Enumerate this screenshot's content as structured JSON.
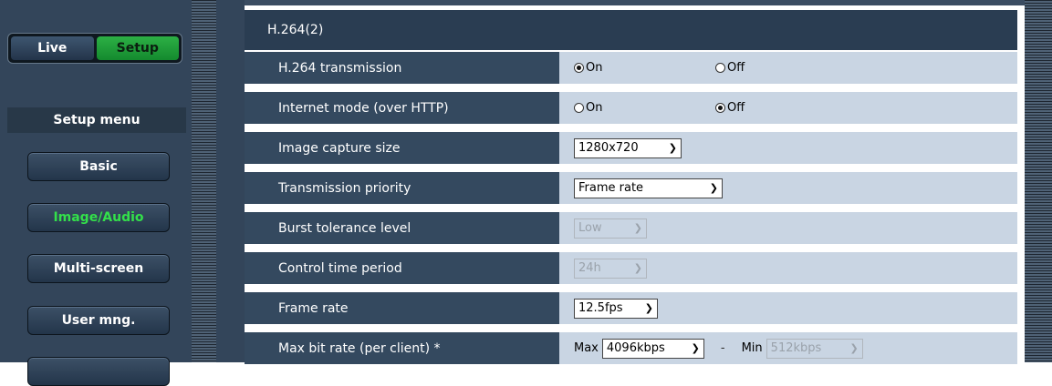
{
  "nav": {
    "live_label": "Live",
    "setup_label": "Setup",
    "menu_title": "Setup menu",
    "items": [
      {
        "label": "Basic"
      },
      {
        "label": "Image/Audio"
      },
      {
        "label": "Multi-screen"
      },
      {
        "label": "User mng."
      }
    ]
  },
  "section": {
    "title": "H.264(2)"
  },
  "rows": {
    "transmission": {
      "label": "H.264 transmission",
      "opt_on": "On",
      "opt_off": "Off",
      "selected": "On"
    },
    "internet_mode": {
      "label": "Internet mode (over HTTP)",
      "opt_on": "On",
      "opt_off": "Off",
      "selected": "Off"
    },
    "capture_size": {
      "label": "Image capture size",
      "value": "1280x720"
    },
    "priority": {
      "label": "Transmission priority",
      "value": "Frame rate"
    },
    "burst": {
      "label": "Burst tolerance level",
      "value": "Low"
    },
    "control_period": {
      "label": "Control time period",
      "value": "24h"
    },
    "frame_rate": {
      "label": "Frame rate",
      "value": "12.5fps"
    },
    "bit_rate": {
      "label": "Max bit rate (per client) *",
      "max_label": "Max",
      "max_value": "4096kbps",
      "separator": "-",
      "min_label": "Min",
      "min_value": "512kbps"
    }
  },
  "colors": {
    "active_menu": "#33e04a",
    "setup_button": "#1a9c38",
    "panel_header": "#2a3d52",
    "label_cell": "#34495f",
    "value_cell": "#c9d5e3"
  }
}
